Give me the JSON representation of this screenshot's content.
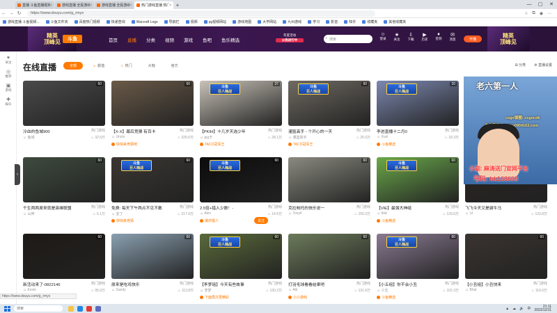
{
  "browser": {
    "tabs": [
      {
        "label": "直播 斗鱼直播视频分享与交流网站",
        "active": false
      },
      {
        "label": "游戏直播 全民游戏直播_斗鱼直播",
        "active": false
      },
      {
        "label": "游戏直播 全民游戏直播_斗鱼直播",
        "active": false
      },
      {
        "label": "热门游戏直播 热门游戏视频_斗鱼",
        "active": true
      }
    ],
    "new_tab": "+",
    "url": "https://www.douyu.com/g_rmyx",
    "window_controls": [
      "—",
      "▢",
      "✕"
    ]
  },
  "bookmarks": [
    "游戏直播 斗鱼视频...",
    "斗鱼文件夹",
    "百度热门视频",
    "快递查询",
    "Warcraft Logs",
    "导航栏",
    "视频",
    "pg视频网站",
    "游戏地图",
    "大学网站",
    "九州游戏",
    "学习",
    "影音",
    "知乎",
    "收藏夹",
    "其他收藏夹"
  ],
  "header": {
    "banner_left": "精英\n顶峰见",
    "banner_right": "精英\n顶峰见",
    "logo": "斗鱼",
    "nav": [
      "首页",
      "直播",
      "分类",
      "视频",
      "游戏",
      "鱼吧",
      "鱼乐精选"
    ],
    "active_nav": "直播",
    "promo_top": "年度活动",
    "promo_badge": "火热进行中",
    "search_placeholder": "搜索",
    "icons": [
      {
        "glyph": "☺",
        "label": "登录"
      },
      {
        "glyph": "★",
        "label": "关注"
      },
      {
        "glyph": "⇩",
        "label": "下载"
      },
      {
        "glyph": "▶",
        "label": "历史"
      },
      {
        "glyph": "♦",
        "label": "签到"
      },
      {
        "glyph": "✉",
        "label": "消息"
      }
    ],
    "live_button": "开播"
  },
  "sidebar": [
    {
      "glyph": "♥",
      "label": "关注"
    },
    {
      "glyph": "◎",
      "label": "推荐"
    },
    {
      "glyph": "▣",
      "label": "游戏"
    },
    {
      "glyph": "✚",
      "label": "娱乐"
    }
  ],
  "sidebar_toggle": "‹",
  "main": {
    "title": "在线直播",
    "filters": [
      {
        "label": "全部",
        "active": true,
        "glyph": ""
      },
      {
        "label": "颜值",
        "active": false,
        "glyph": "☺"
      },
      {
        "label": "热门",
        "active": false,
        "glyph": "♨"
      },
      {
        "label": "大咖",
        "active": false,
        "glyph": ""
      },
      {
        "label": "官方",
        "active": false,
        "glyph": ""
      }
    ],
    "tools": [
      "⊞ 分类",
      "⚙ 直播设置"
    ]
  },
  "cards": [
    {
      "title": "冷血的鱼城900",
      "cat": "热门游戏",
      "streamer": "鱼城",
      "heat": "32.5万",
      "tag": "",
      "badge": "60",
      "color": "#4a4a4a",
      "ad": false
    },
    {
      "title": "【X-X】幕后竞猜 有百卡",
      "cat": "热门游戏",
      "streamer": "Uncle",
      "heat": "329.6万",
      "tag": "快快来竞猜吧",
      "badge": "60",
      "color": "#6a5a48",
      "ad": false
    },
    {
      "title": "【PKIH】十几岁天选少年",
      "cat": "热门游戏",
      "streamer": "pig卡",
      "heat": "28.1万",
      "tag": "TACO冠军王",
      "badge": "37",
      "color": "#c8c2b8",
      "ad": true
    },
    {
      "title": "灌篮高手 - 个开心的一天",
      "cat": "热门游戏",
      "streamer": "灌篮高手",
      "heat": "25.6万",
      "tag": "TACO冠军王",
      "badge": "60",
      "color": "#6f6a62",
      "ad": true
    },
    {
      "title": "李进直播十二月0",
      "cat": "热门游戏",
      "streamer": "Xuxi",
      "heat": "18.3万",
      "tag": "斗鱼精选",
      "badge": "20",
      "color": "#7c88b0",
      "ad": true
    },
    {
      "title": "【人物】老六第一人",
      "cat": "热门游戏",
      "streamer": "老六",
      "heat": "16.2万",
      "tag": "",
      "badge": "60",
      "color": "#101820",
      "ad": false
    },
    {
      "title": "千生两两原来就是英雄联盟",
      "cat": "热门游戏",
      "streamer": "山神",
      "heat": "5.1万",
      "tag": "",
      "badge": "60",
      "color": "#3e4a3e",
      "ad": false
    },
    {
      "title": "免费: 每天下午两点不见不散",
      "cat": "热门游戏",
      "streamer": "亚丁",
      "heat": "217.6万",
      "tag": "快快来竞猜",
      "badge": "60",
      "color": "#3a3632",
      "ad": true
    },
    {
      "title": "2.5倍+猎人少数！-",
      "cat": "热门游戏",
      "streamer": "Alev",
      "heat": "14.5万",
      "tag": "爆炸猎人",
      "badge": "60",
      "color": "#0c0c0c",
      "ad": true
    },
    {
      "title": "克拉帕托的快乐说一",
      "cat": "热门游戏",
      "streamer": "TonyF",
      "heat": "150.2万",
      "tag": "",
      "badge": "60",
      "color": "#8a8a80",
      "ad": false
    },
    {
      "title": "【VIE】最强大神组",
      "cat": "热门游戏",
      "streamer": "Ibid",
      "heat": "129.6万",
      "tag": "斗鱼精选",
      "badge": "60",
      "color": "#6aa84a",
      "ad": true
    },
    {
      "title": "飞飞今天又是骑牛马",
      "cat": "热门游戏",
      "streamer": "Lil",
      "heat": "123.8万",
      "tag": "",
      "badge": "60",
      "color": "#2a2420",
      "ad": false
    },
    {
      "title": "新活动来了-0822146",
      "cat": "热门游戏",
      "streamer": "Kevin",
      "heat": "95.6万",
      "tag": "小小游戏",
      "badge": "60",
      "color": "#1e1a16",
      "ad": false
    },
    {
      "title": "原来是吃鸡快乐",
      "cat": "热门游戏",
      "streamer": "Sandy",
      "heat": "113.8万",
      "tag": "",
      "badge": "60",
      "color": "#8aa0b0",
      "ad": false
    },
    {
      "title": "【李梦瑶】今天有些故事",
      "cat": "热门游戏",
      "streamer": "李梦",
      "heat": "130.2万",
      "tag": "下面再次更精彩",
      "badge": "60",
      "color": "#5a6a3a",
      "ad": true
    },
    {
      "title": "打羽毛球看看结果吧",
      "cat": "热门游戏",
      "streamer": "Atk",
      "heat": "131.6万",
      "tag": "小小游戏",
      "badge": "60",
      "color": "#6c7a5a",
      "ad": false
    },
    {
      "title": "【小五组】你不会小丑",
      "cat": "热门游戏",
      "streamer": "小五",
      "heat": "102.3万",
      "tag": "斗鱼精选",
      "badge": "60",
      "color": "#8a7a92",
      "ad": true
    },
    {
      "title": "【小丑组】小丑快来",
      "cat": "热门游戏",
      "streamer": "Bhal",
      "heat": "119.6万",
      "tag": "",
      "badge": "60",
      "color": "#3a3430",
      "ad": false
    }
  ],
  "ad_text": [
    "斗鱼",
    "巨人嗨战"
  ],
  "overlay": {
    "line1": "csgo钢圈: csgocdk",
    "line2": "自主微信: daizhu0904163.com",
    "line3": "小副: 麻涛送门官网平台",
    "line4": "号码: hk168698"
  },
  "follow_label": "关注",
  "status_url": "https://www.douyu.com/g_rmyx",
  "taskbar": {
    "search": "搜索",
    "time": "21:11",
    "date": "2023/12/11",
    "lang": "中",
    "tray_icons": [
      "▲",
      "☁",
      "🔊"
    ]
  }
}
